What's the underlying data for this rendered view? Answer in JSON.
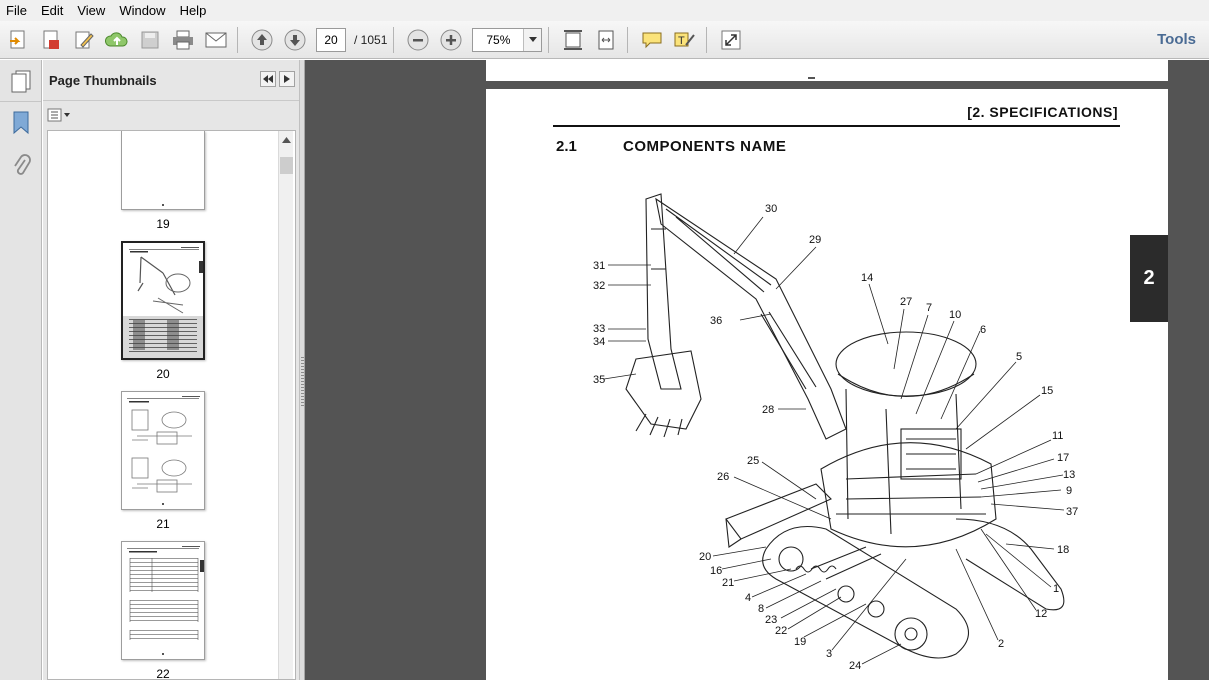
{
  "menu": [
    "File",
    "Edit",
    "View",
    "Window",
    "Help"
  ],
  "toolbar": {
    "current_page": "20",
    "page_total": "/  1051",
    "zoom": "75%",
    "tools_label": "Tools"
  },
  "thumbnails_panel": {
    "title": "Page Thumbnails",
    "thumbs": [
      {
        "label": "19"
      },
      {
        "label": "20"
      },
      {
        "label": "21"
      },
      {
        "label": "22"
      }
    ]
  },
  "document": {
    "header": "[2.   SPECIFICATIONS]",
    "section_number": "2.1",
    "section_title": "COMPONENTS NAME",
    "side_tab": "2",
    "callouts": [
      "30",
      "29",
      "31",
      "32",
      "14",
      "27",
      "7",
      "10",
      "6",
      "36",
      "33",
      "34",
      "5",
      "35",
      "15",
      "28",
      "11",
      "25",
      "17",
      "26",
      "13",
      "9",
      "37",
      "20",
      "18",
      "16",
      "21",
      "1",
      "4",
      "8",
      "23",
      "12",
      "22",
      "19",
      "2",
      "3",
      "24"
    ]
  }
}
